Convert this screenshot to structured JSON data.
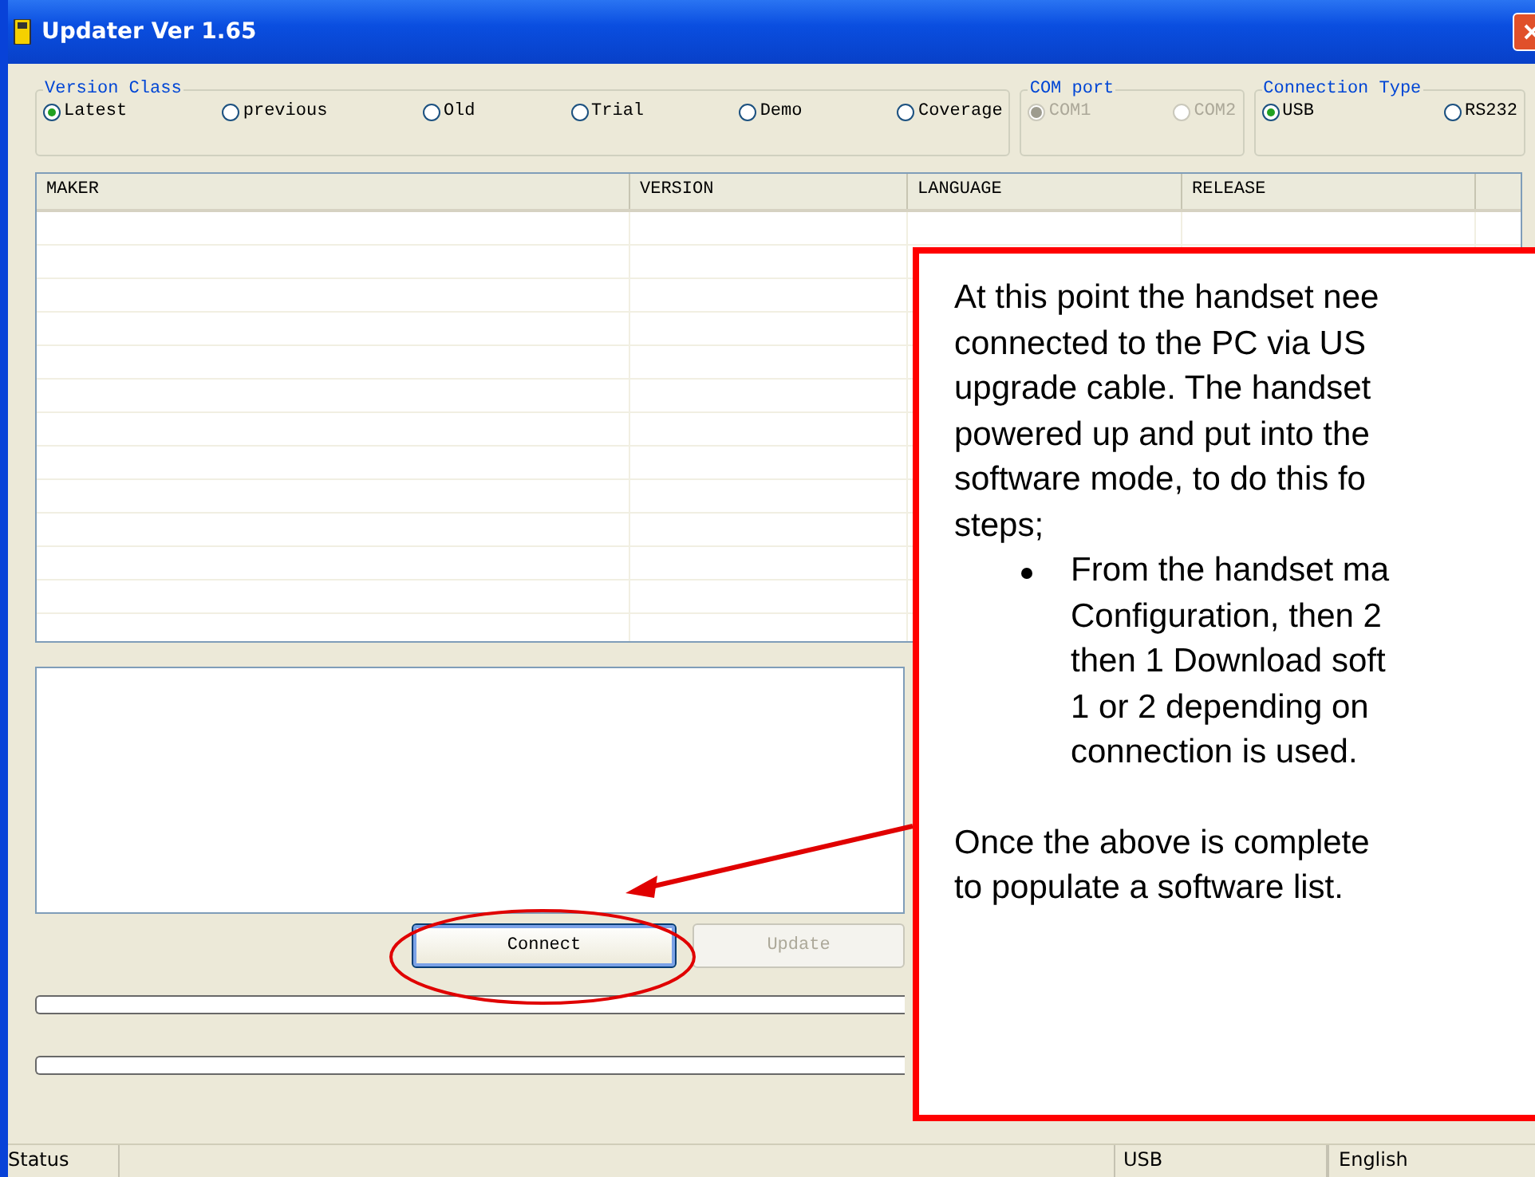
{
  "window": {
    "title": "Updater Ver 1.65"
  },
  "groups": [
    {
      "title": "Version Class",
      "disabled": false,
      "options": [
        {
          "label": "Latest",
          "selected": true
        },
        {
          "label": "previous",
          "selected": false
        },
        {
          "label": "Old",
          "selected": false
        },
        {
          "label": "Trial",
          "selected": false
        },
        {
          "label": "Demo",
          "selected": false
        },
        {
          "label": "Coverage",
          "selected": false
        }
      ]
    },
    {
      "title": "COM port",
      "disabled": true,
      "options": [
        {
          "label": "COM1",
          "selected": true
        },
        {
          "label": "COM2",
          "selected": false
        }
      ]
    },
    {
      "title": "Connection Type",
      "disabled": false,
      "options": [
        {
          "label": "USB",
          "selected": true
        },
        {
          "label": "RS232",
          "selected": false
        }
      ]
    }
  ],
  "table": {
    "columns": [
      "MAKER",
      "VERSION",
      "LANGUAGE",
      "RELEASE"
    ]
  },
  "buttons": [
    {
      "label": "Connect",
      "disabled": false
    },
    {
      "label": "Update",
      "disabled": true
    }
  ],
  "progress_bars": [
    {
      "level": 0
    },
    {
      "level": 0
    }
  ],
  "status_bar": [
    "Status",
    "USB",
    "English"
  ],
  "callout": {
    "lines": [
      "At this point the handset nee",
      "connected to the PC via US",
      "upgrade cable. The handset",
      "powered up and put into the",
      "software mode, to do this fo",
      "steps;"
    ],
    "bullet_lines": [
      "From the handset ma",
      "Configuration, then 2",
      "then 1 Download soft",
      "1 or 2 depending on",
      "connection is used."
    ],
    "closing_lines": [
      "Once the above is complete",
      "to populate a software list."
    ]
  }
}
